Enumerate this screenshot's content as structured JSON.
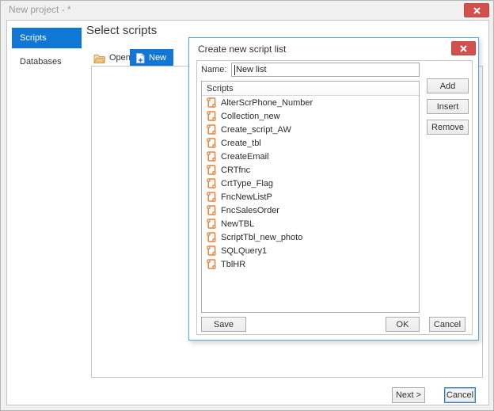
{
  "window": {
    "title": "New project - *"
  },
  "sidebar": {
    "items": [
      {
        "label": "Scripts",
        "selected": true
      },
      {
        "label": "Databases",
        "selected": false
      }
    ]
  },
  "main": {
    "heading": "Select scripts",
    "tabs": [
      {
        "label": "Open",
        "icon": "open-folder-icon",
        "selected": false
      },
      {
        "label": "New",
        "icon": "new-document-icon",
        "selected": true
      }
    ],
    "footer": {
      "next_label": "Next >",
      "cancel_label": "Cancel"
    }
  },
  "dialog": {
    "title": "Create new script list",
    "name_label": "Name:",
    "name_value": "New list",
    "list_header": "Scripts",
    "scripts": [
      "AlterScrPhone_Number",
      "Collection_new",
      "Create_script_AW",
      "Create_tbl",
      "CreateEmail",
      "CRTfnc",
      "CrtType_Flag",
      "FncNewListP",
      "FncSalesOrder",
      "NewTBL",
      "ScriptTbl_new_photo",
      "SQLQuery1",
      "TblHR"
    ],
    "buttons": {
      "add": "Add",
      "insert": "Insert",
      "remove": "Remove",
      "save": "Save",
      "ok": "OK",
      "cancel": "Cancel"
    }
  },
  "colors": {
    "accent_blue": "#1177d7",
    "dialog_border": "#57a7e5",
    "close_red": "#d2514e",
    "script_icon_orange": "#e8823c"
  }
}
